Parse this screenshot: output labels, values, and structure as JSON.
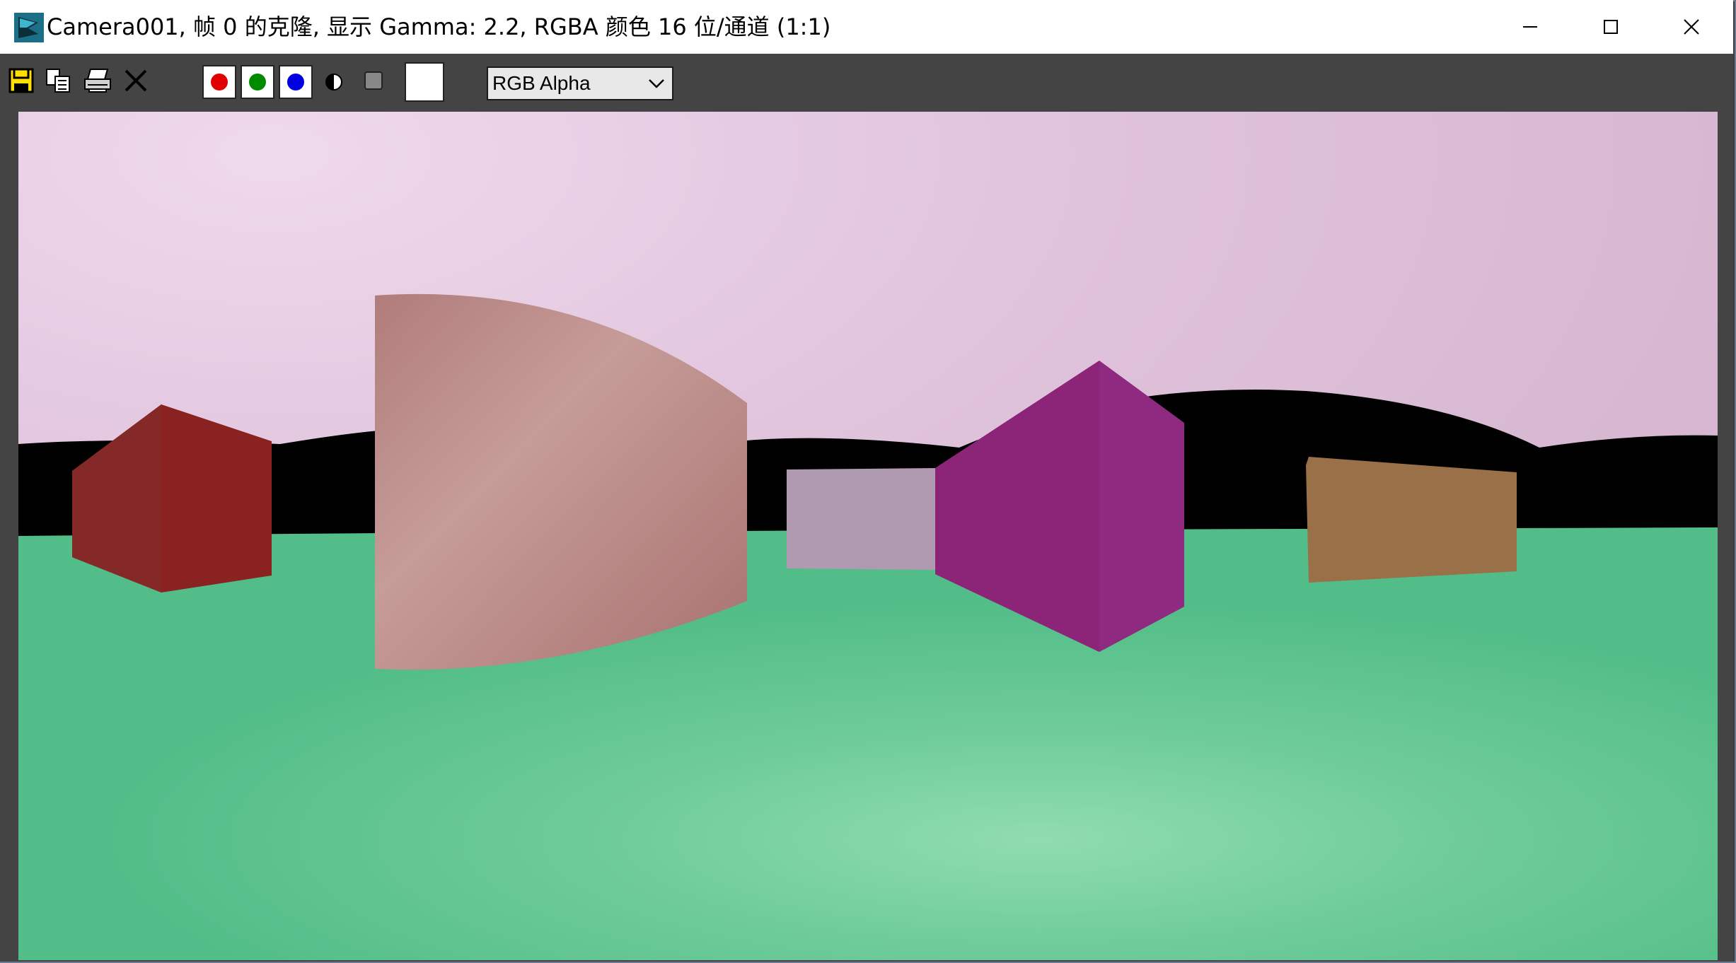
{
  "window": {
    "title": "Camera001, 帧 0 的克隆, 显示 Gamma: 2.2, RGBA 颜色 16 位/通道 (1:1)",
    "app_icon": "3dsmax-logo-icon",
    "controls": {
      "minimize": "minimize-icon",
      "maximize": "maximize-icon",
      "close": "close-icon"
    }
  },
  "toolbar": {
    "file_icons": [
      "save-icon",
      "copy-icon",
      "print-icon",
      "clear-icon"
    ],
    "channels": [
      {
        "name": "red-channel",
        "color": "#e00000"
      },
      {
        "name": "green-channel",
        "color": "#008a00"
      },
      {
        "name": "blue-channel",
        "color": "#0000e0"
      }
    ],
    "extra_icons": [
      "monochrome-icon",
      "alpha-toggle-icon"
    ],
    "swatch_color": "#ffffff",
    "channel_display": {
      "selected": "RGB Alpha"
    }
  },
  "render": {
    "sky_color": "#dcc0d8",
    "ground_color": "#55c08e",
    "horizon_color": "#000000",
    "objects": [
      {
        "name": "red-box",
        "color": "#8a2222"
      },
      {
        "name": "pink-box",
        "color": "#b47a78"
      },
      {
        "name": "lavender-box",
        "color": "#b09ab2"
      },
      {
        "name": "magenta-box",
        "color": "#8e2a80"
      },
      {
        "name": "brown-box",
        "color": "#9a7048"
      }
    ]
  }
}
